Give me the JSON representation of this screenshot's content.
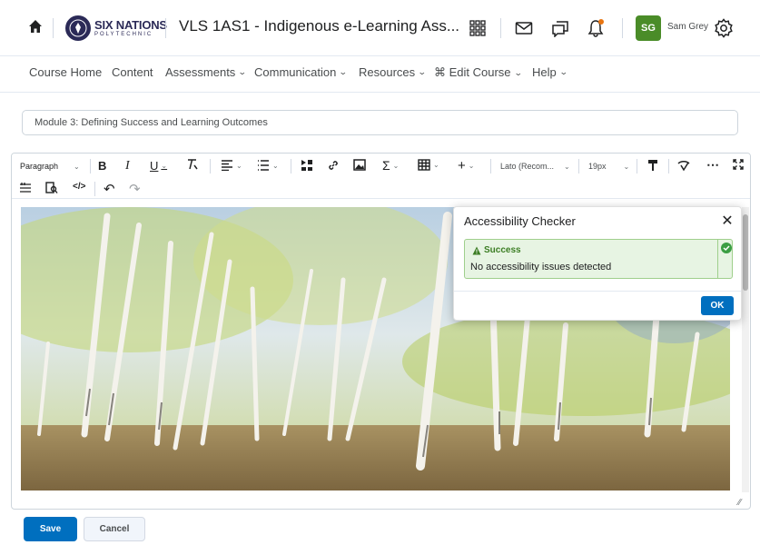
{
  "brand": {
    "logo_main": "SIX NATIONS",
    "logo_sub": "POLYTECHNIC"
  },
  "header": {
    "course_title": "VLS 1AS1 - Indigenous e-Learning Ass...",
    "user_initials": "SG",
    "user_name": "Sam Grey",
    "notification_color": "#e87511"
  },
  "nav": {
    "items": [
      {
        "label": "Course Home",
        "dropdown": false
      },
      {
        "label": "Content",
        "dropdown": false
      },
      {
        "label": "Assessments",
        "dropdown": true
      },
      {
        "label": "Communication",
        "dropdown": true
      },
      {
        "label": "Resources",
        "dropdown": true
      },
      {
        "label": "⌘ Edit Course",
        "dropdown": true
      },
      {
        "label": "Help",
        "dropdown": true
      }
    ]
  },
  "topic_title": {
    "value": "Module 3: Defining Success and Learning Outcomes"
  },
  "toolbar": {
    "paragraph_format": "Paragraph",
    "font_family": "Lato (Recom...",
    "font_size": "19px"
  },
  "accessibility_dialog": {
    "title": "Accessibility Checker",
    "status_title": "Success",
    "status_message": "No accessibility issues detected",
    "ok_label": "OK"
  },
  "actions": {
    "save_label": "Save",
    "cancel_label": "Cancel"
  },
  "colors": {
    "primary": "#006fbf",
    "success": "#3b7d23",
    "avatar": "#4a8c28",
    "brand": "#2b2a57"
  }
}
